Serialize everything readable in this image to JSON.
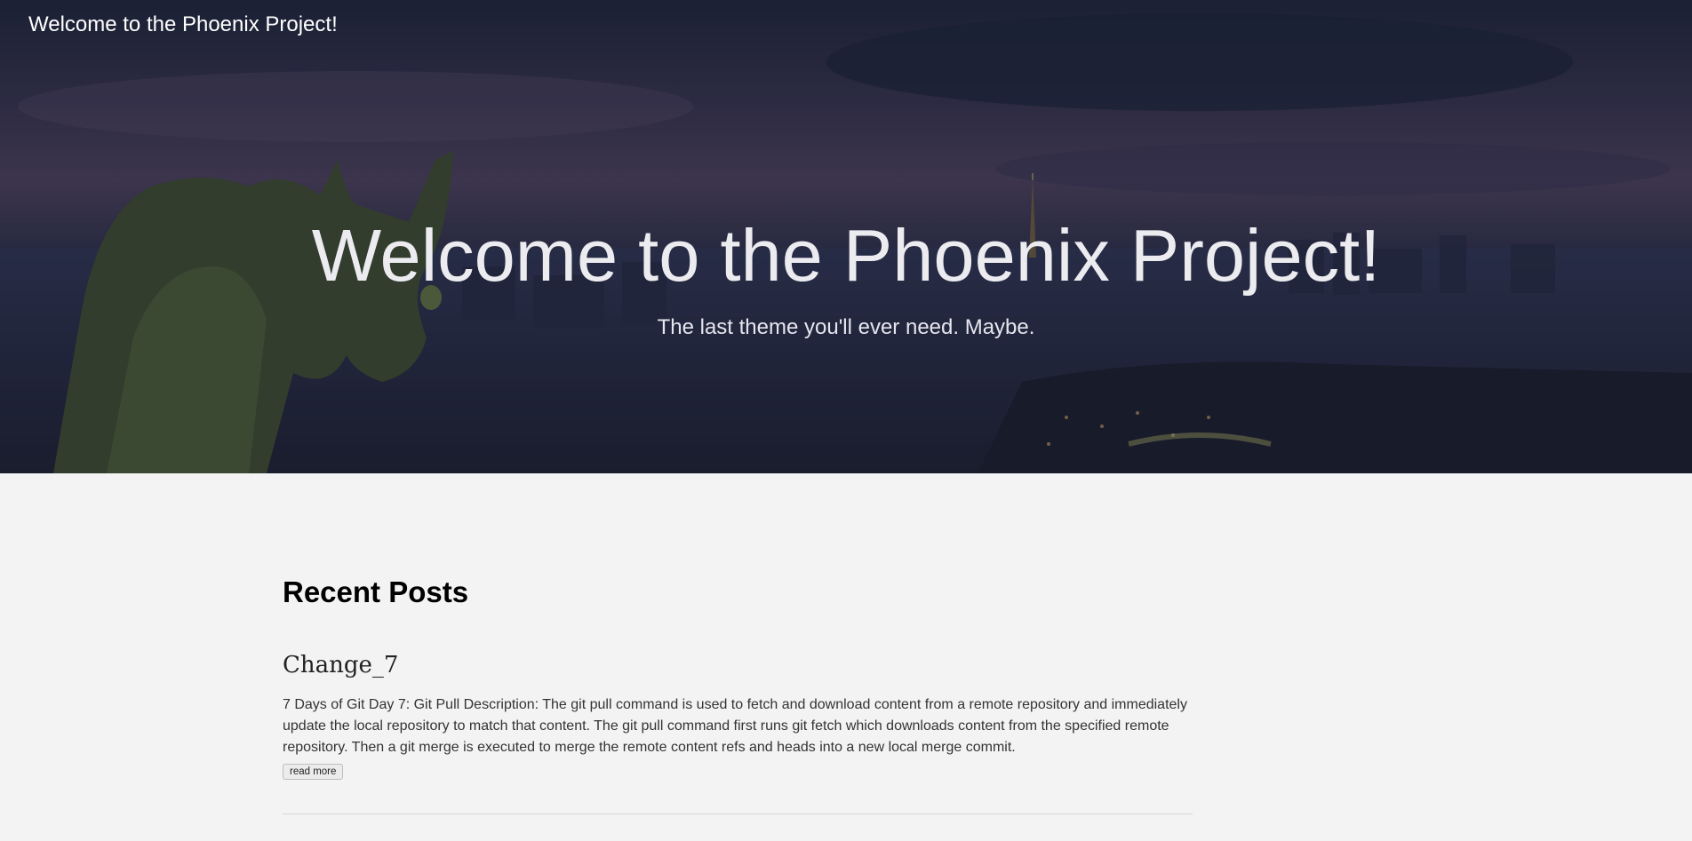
{
  "header": {
    "site_title": "Welcome to the Phoenix Project!"
  },
  "hero": {
    "heading": "Welcome to the Phoenix Project!",
    "subheading": "The last theme you'll ever need. Maybe."
  },
  "main": {
    "section_title": "Recent Posts",
    "posts": [
      {
        "title": "Change_7",
        "summary": "7 Days of Git Day 7: Git Pull Description: The git pull command is used to fetch and download content from a remote repository and immediately update the local repository to match that content. The git pull command first runs git fetch which downloads content from the specified remote repository. Then a git merge is executed to merge the remote content refs and heads into a new local merge commit.",
        "read_more_label": "read more"
      }
    ]
  },
  "colors": {
    "page_background": "#f3f3f3",
    "hero_text": "#ececf0",
    "divider": "#d6d6d6"
  }
}
